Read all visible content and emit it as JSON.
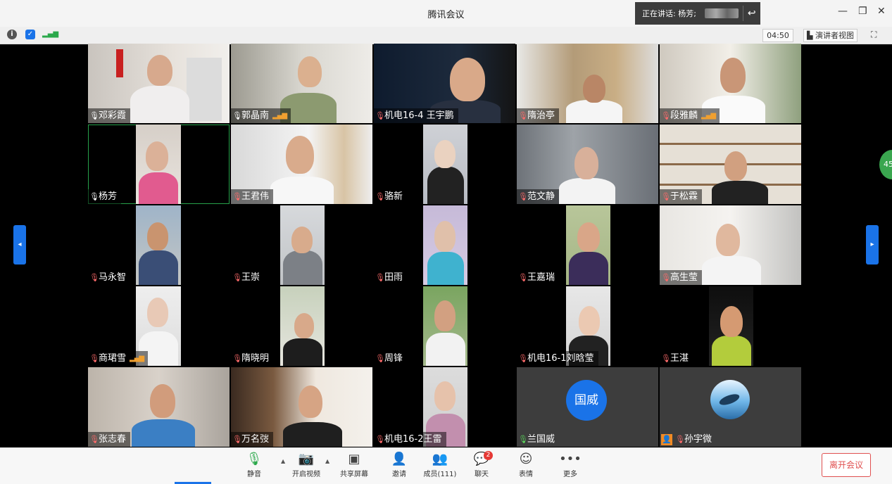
{
  "window": {
    "title": "腾讯会议",
    "speaking_label": "正在讲话: 杨芳;"
  },
  "toolbar": {
    "timer": "04:50",
    "presenter_view": "演讲者视图"
  },
  "participants": [
    {
      "name": "邓彩霞",
      "muted": false,
      "signal": false
    },
    {
      "name": "郭晶南",
      "muted": false,
      "signal": true
    },
    {
      "name": "机电16-4 王宇鹏",
      "muted": true,
      "signal": false
    },
    {
      "name": "隋治亭",
      "muted": true,
      "signal": false
    },
    {
      "name": "段雅麟",
      "muted": true,
      "signal": true
    },
    {
      "name": "杨芳",
      "muted": false,
      "signal": false
    },
    {
      "name": "王君伟",
      "muted": true,
      "signal": false
    },
    {
      "name": "骆新",
      "muted": true,
      "signal": false
    },
    {
      "name": "范文静",
      "muted": true,
      "signal": false
    },
    {
      "name": "于松霖",
      "muted": true,
      "signal": false
    },
    {
      "name": "马永智",
      "muted": true,
      "signal": false
    },
    {
      "name": "王崇",
      "muted": true,
      "signal": false
    },
    {
      "name": "田雨",
      "muted": true,
      "signal": false
    },
    {
      "name": "王嘉瑞",
      "muted": true,
      "signal": false
    },
    {
      "name": "高生莹",
      "muted": true,
      "signal": false
    },
    {
      "name": "商珺雪",
      "muted": true,
      "signal": true
    },
    {
      "name": "隋晓明",
      "muted": true,
      "signal": false
    },
    {
      "name": "周锋",
      "muted": true,
      "signal": false
    },
    {
      "name": "机电16-1刘晗莹",
      "muted": true,
      "signal": false
    },
    {
      "name": "王湛",
      "muted": true,
      "signal": false
    },
    {
      "name": "张志春",
      "muted": true,
      "signal": false
    },
    {
      "name": "万名弢",
      "muted": true,
      "signal": false
    },
    {
      "name": "机电16-2王雷",
      "muted": true,
      "signal": false
    },
    {
      "name": "兰国威",
      "muted": false,
      "signal": false,
      "avatar_text": "国威"
    },
    {
      "name": "孙宇微",
      "muted": true,
      "signal": false
    }
  ],
  "side_bubble": "45",
  "bottom": {
    "mute": "静音",
    "video": "开启视频",
    "share": "共享屏幕",
    "invite": "邀请",
    "members": "成员(111)",
    "chat": "聊天",
    "chat_badge": "2",
    "emoji": "表情",
    "more": "更多",
    "leave": "离开会议"
  },
  "colors": {
    "accent": "#1a73e8",
    "leave": "#e05050",
    "active_border": "#27a14a"
  }
}
